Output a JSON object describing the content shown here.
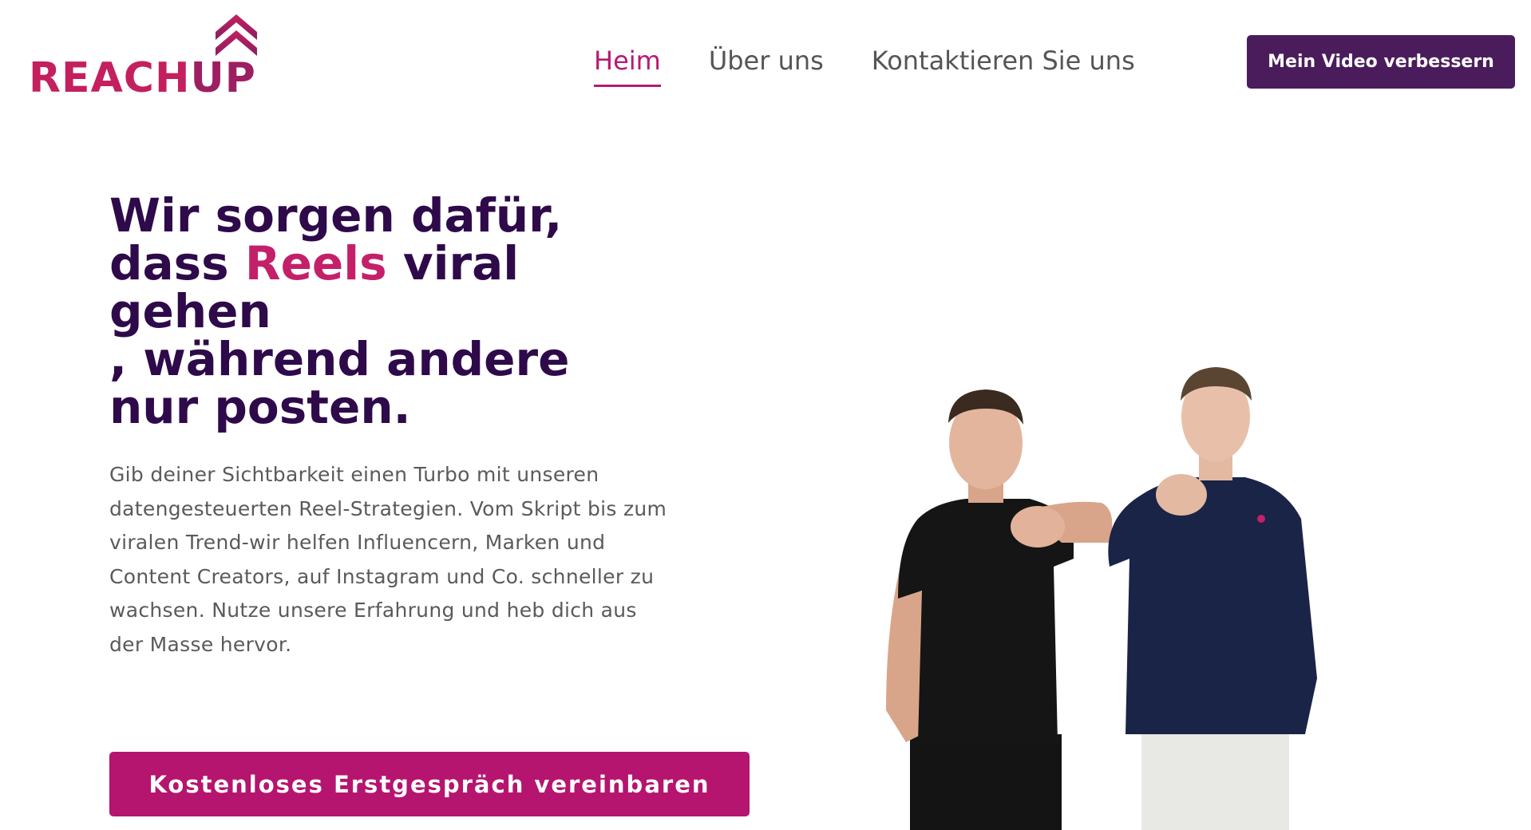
{
  "logo": {
    "text_a": "REACH",
    "text_b": "UP",
    "icon": "double-chevron-up-arrow-icon"
  },
  "nav": {
    "items": [
      {
        "label": "Heim",
        "active": true
      },
      {
        "label": "Über uns",
        "active": false
      },
      {
        "label": "Kontaktieren Sie uns",
        "active": false
      }
    ]
  },
  "header_cta": "Mein Video verbessern",
  "hero": {
    "headline_l1": "Wir sorgen dafür,",
    "headline_l2_a": "dass ",
    "headline_l2_accent": "Reels",
    "headline_l2_b": " viral",
    "headline_l3": "gehen",
    "headline_l4": ", während andere",
    "headline_l5": "nur posten.",
    "lead": "Gib deiner Sichtbarkeit einen Turbo mit unseren datengesteuerten Reel-Strategien. Vom Skript bis zum viralen Trend-wir helfen Influencern, Marken und Content Creators, auf Instagram und Co. schneller zu wachsen. Nutze unsere Erfahrung und heb dich aus der Masse hervor.",
    "cta": "Kostenloses Erstgespräch vereinbaren"
  },
  "colors": {
    "brand_purple": "#4a1c5c",
    "headline": "#2e0a4a",
    "accent_pink": "#c4206a",
    "cta_magenta": "#b5146f",
    "nav_active": "#b71a72"
  }
}
